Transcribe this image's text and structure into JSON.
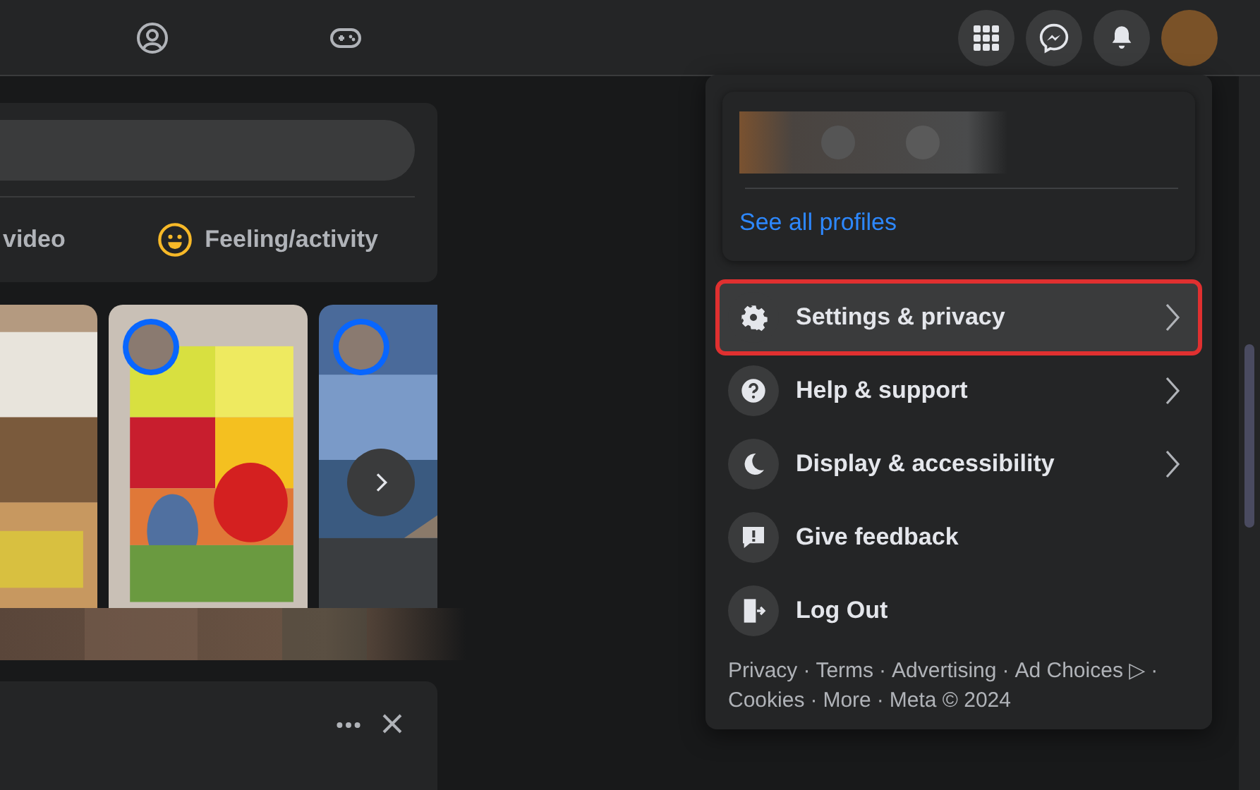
{
  "composer": {
    "actions": [
      {
        "kind": "video",
        "label": "video"
      },
      {
        "kind": "feeling",
        "label": "Feeling/activity"
      }
    ]
  },
  "stories": [
    {
      "kind": "picture"
    },
    {
      "kind": "picture",
      "avatar": true
    },
    {
      "kind": "picture",
      "avatar": true
    }
  ],
  "menu": {
    "profile": {
      "link": "See all profiles"
    },
    "items": [
      {
        "label": "Settings & privacy",
        "submenu": true,
        "selected": true
      },
      {
        "label": "Help & support",
        "submenu": true,
        "selected": false
      },
      {
        "label": "Display & accessibility",
        "submenu": true,
        "selected": false
      },
      {
        "label": "Give feedback",
        "submenu": false,
        "selected": false
      },
      {
        "label": "Log Out",
        "submenu": false,
        "selected": false
      }
    ],
    "footer": [
      "Privacy",
      "Terms",
      "Advertising",
      "Ad Choices ▷",
      "Cookies",
      "More",
      "Meta © 2024"
    ],
    "separator": "·"
  }
}
